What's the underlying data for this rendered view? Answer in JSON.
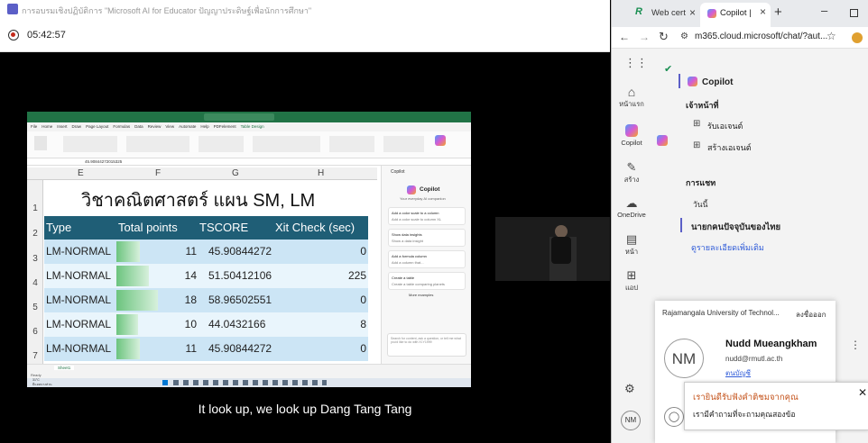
{
  "meeting": {
    "title": "การอบรมเชิงปฏิบัติการ \"Microsoft AI for Educator ปัญญาประดิษฐ์เพื่อนักการศึกษา\"",
    "timer": "05:42:57",
    "caption": "It look up, we look up Dang Tang Tang"
  },
  "excel": {
    "sheet_title": "วิชาคณิตศาสตร์ แผน SM, LM",
    "formula_value": "45.90844272015325",
    "ribbon_tabs": [
      "File",
      "Home",
      "Insert",
      "Draw",
      "Page Layout",
      "Formulas",
      "Data",
      "Review",
      "View",
      "Automate",
      "Help",
      "PDFelement",
      "Table Design"
    ],
    "col_letters": [
      "E",
      "F",
      "G",
      "H"
    ],
    "headers": [
      "Type",
      "Total points",
      "TSCORE",
      "Xit Check (sec)"
    ],
    "rows": [
      {
        "n": "3",
        "type": "LM-NORMAL",
        "points": "11",
        "tscore": "45.90844272",
        "xit": "0"
      },
      {
        "n": "4",
        "type": "LM-NORMAL",
        "points": "14",
        "tscore": "51.50412106",
        "xit": "225"
      },
      {
        "n": "5",
        "type": "LM-NORMAL",
        "points": "18",
        "tscore": "58.96502551",
        "xit": "0"
      },
      {
        "n": "6",
        "type": "LM-NORMAL",
        "points": "10",
        "tscore": "44.0432166",
        "xit": "8"
      },
      {
        "n": "7",
        "type": "LM-NORMAL",
        "points": "11",
        "tscore": "45.90844272",
        "xit": "0"
      }
    ],
    "copilot_pane": {
      "title": "Copilot",
      "heading": "Copilot",
      "subtitle": "Your everyday AI companion",
      "cards": [
        {
          "title": "Add a color scale to a column",
          "sub": "Add a color scale to column XL"
        },
        {
          "title": "Show data insights",
          "sub": "Show a data insight"
        },
        {
          "title": "Add a formula column",
          "sub": "Add a column that..."
        },
        {
          "title": "Create a table",
          "sub": "Create a table comparing planets"
        }
      ],
      "more": "More examples",
      "input_placeholder": "Search for content, ask a question, or tell me what you'd like to do with Xl.Y1999"
    },
    "sheet_tab": "Sheet1",
    "status": "Ready"
  },
  "taskbar": {
    "weather": "31°C",
    "weather_sub": "มีแดดบางส่วน"
  },
  "browser": {
    "tabs": [
      {
        "label": "Web cert"
      },
      {
        "label": "Copilot |"
      }
    ],
    "url": "m365.cloud.microsoft/chat/?aut...",
    "rail": [
      {
        "label": "หน้าแรก",
        "icon": "home-icon"
      },
      {
        "label": "Copilot",
        "icon": "copilot-icon"
      },
      {
        "label": "สร้าง",
        "icon": "pen-icon"
      },
      {
        "label": "OneDrive",
        "icon": "cloud-icon"
      },
      {
        "label": "หน้า",
        "icon": "page-icon"
      },
      {
        "label": "แอป",
        "icon": "apps-icon"
      }
    ],
    "panel": {
      "title": "Copilot",
      "home_label": "เจ้าหน้าที่",
      "nav": [
        {
          "label": "รับเอเจนต์",
          "icon": "grid-icon"
        },
        {
          "label": "สร้างเอเจนต์",
          "icon": "plus-box-icon"
        }
      ],
      "chats_label": "การแชท",
      "today_label": "วันนี้",
      "chat_item": "นายกคนปัจจุบันของไทย",
      "more_link": "ดูรายละเอียดเพิ่มเติม"
    },
    "account": {
      "org": "Rajamangala University of Technol...",
      "signout": "ลงชื่อออก",
      "initials": "NM",
      "name": "Nudd Mueangkham",
      "email": "nudd@rmutl.ac.th",
      "profile_link": "ตนบัญชี"
    },
    "toast": {
      "title": "เรายินดีรับฟังคำติชมจากคุณ",
      "body": "เรามีคำถามที่จะถามคุณสองข้อ"
    },
    "user_initials": "NM"
  },
  "colors": {
    "excel_green": "#217346",
    "header_teal": "#1f5e76",
    "row_blue": "#cce5f5",
    "row_light": "#e9f5fc",
    "accent_link": "#2f5bd8",
    "toast_orange": "#c4521a"
  }
}
